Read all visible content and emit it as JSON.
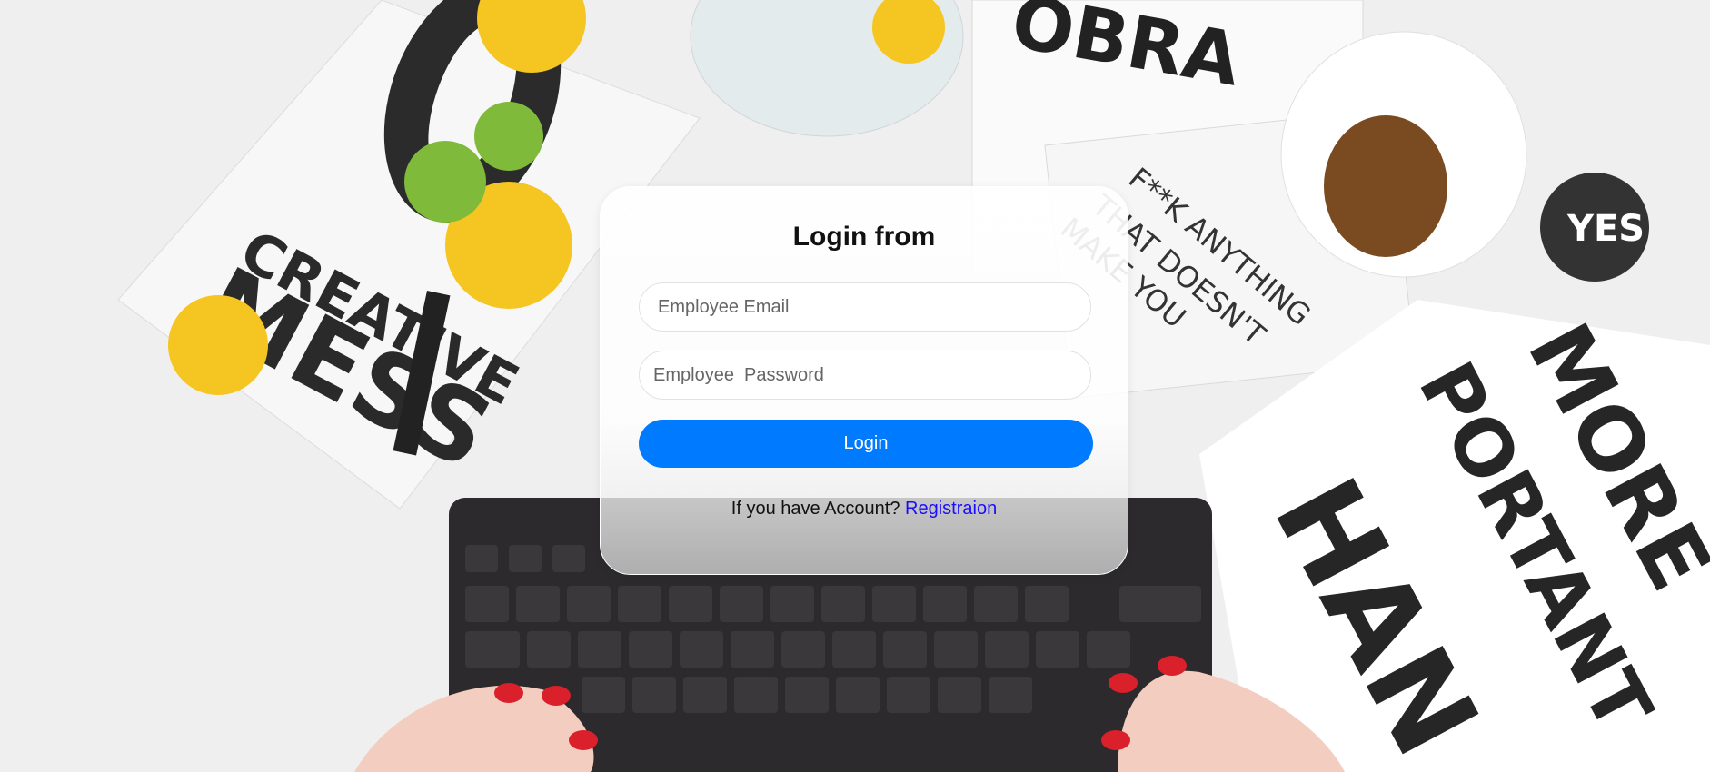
{
  "login_form": {
    "title": "Login from",
    "email_placeholder": "Employee Email",
    "password_placeholder": "Employee  Password",
    "login_button": "Login",
    "account_prompt": "If you have Account?",
    "register_link": "Registraion"
  },
  "colors": {
    "button": "#007bff",
    "link": "#1a0dff"
  }
}
